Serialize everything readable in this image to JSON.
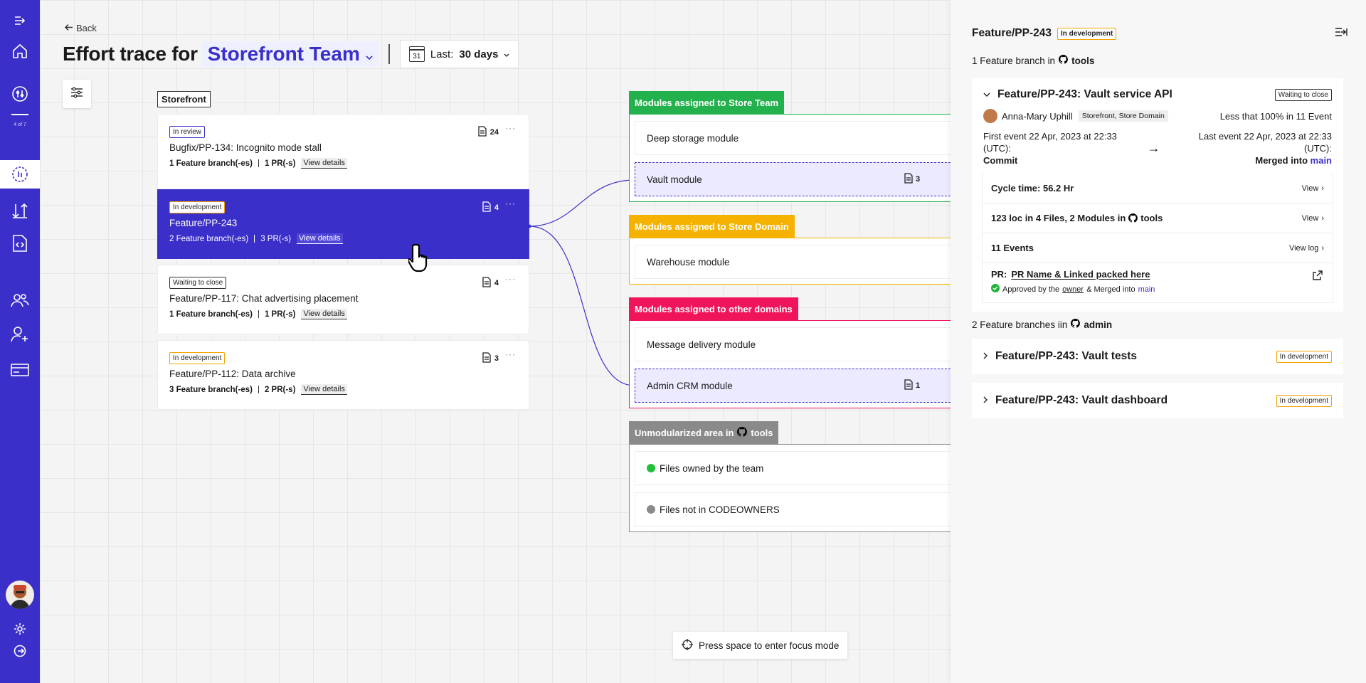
{
  "nav": {
    "step_label": "4 of 7"
  },
  "header": {
    "back_label": "Back",
    "title": "Effort trace for",
    "team": "Storefront Team",
    "date_prefix": "Last:",
    "date_value": "30 days",
    "calendar_day": "31"
  },
  "storefront": {
    "label": "Storefront",
    "cards": [
      {
        "status": "In review",
        "name": "Bugfix/PP-134: Incognito mode stall",
        "branches": "1 Feature branch(-es)",
        "prs": "1 PR(-s)",
        "details": "View details",
        "count": "24"
      },
      {
        "status": "In development",
        "name": "Feature/PP-243",
        "branches": "2 Feature branch(-es)",
        "prs": "3 PR(-s)",
        "details": "View details",
        "count": "4"
      },
      {
        "status": "Waiting to close",
        "name": "Feature/PP-117: Chat advertising placement",
        "branches": "1 Feature branch(-es)",
        "prs": "1 PR(-s)",
        "details": "View details",
        "count": "4"
      },
      {
        "status": "In development",
        "name": "Feature/PP-112: Data archive",
        "branches": "3 Feature branch(-es)",
        "prs": "2 PR(-s)",
        "details": "View details",
        "count": "3"
      }
    ]
  },
  "modules": {
    "store_team": {
      "title": "Modules assigned to Store Team",
      "color": "#22b14c",
      "items": [
        "Deep storage module",
        "Vault module"
      ],
      "vault_count": "3"
    },
    "store_domain": {
      "title": "Modules assigned to Store Domain",
      "color": "#f5b300",
      "items": [
        "Warehouse module"
      ]
    },
    "other": {
      "title": "Modules assigned to other domains",
      "color": "#f0145a",
      "items": [
        "Message delivery module",
        "Admin CRM module"
      ],
      "admin_count": "1"
    },
    "unmod": {
      "title": "Unmodularized area in",
      "repo": "tools",
      "color": "#8a8a8a",
      "items": [
        "Files owned by the team",
        "Files not in CODEOWNERS"
      ]
    }
  },
  "focus_hint": "Press space to enter focus mode",
  "panel": {
    "title": "Feature/PP-243",
    "status": "In development",
    "sub1_prefix": "1 Feature branch in",
    "sub1_repo": "tools",
    "branch": {
      "title": "Feature/PP-243: Vault service API",
      "status": "Waiting to close",
      "author": "Anna-Mary Uphill",
      "tag": "Storefront, Store Domain",
      "summary": "Less that 100% in 11 Event",
      "first_event_line": "First event 22 Apr, 2023 at 22:33 (UTC):",
      "first_event_value": "Commit",
      "last_event_line": "Last event 22 Apr, 2023 at 22:33 (UTC):",
      "last_event_prefix": "Merged into",
      "last_event_link": "main",
      "cycle_time": "Cycle time: 56.2 Hr",
      "cycle_view": "View",
      "loc_text": "123 loc in 4 Files, 2 Modules in",
      "loc_repo": "tools",
      "loc_view": "View",
      "events": "11 Events",
      "events_view": "View log",
      "pr_prefix": "PR:",
      "pr_name": "PR Name & Linked packed here",
      "pr_status_a": "Approved by the",
      "pr_status_owner": "owner",
      "pr_status_b": "& Merged into",
      "pr_status_link": "main"
    },
    "sub2_prefix": "2 Feature branches iin",
    "sub2_repo": "admin",
    "other_branches": [
      {
        "title": "Feature/PP-243: Vault tests",
        "status": "In development"
      },
      {
        "title": "Feature/PP-243: Vault dashboard",
        "status": "In development"
      }
    ]
  }
}
